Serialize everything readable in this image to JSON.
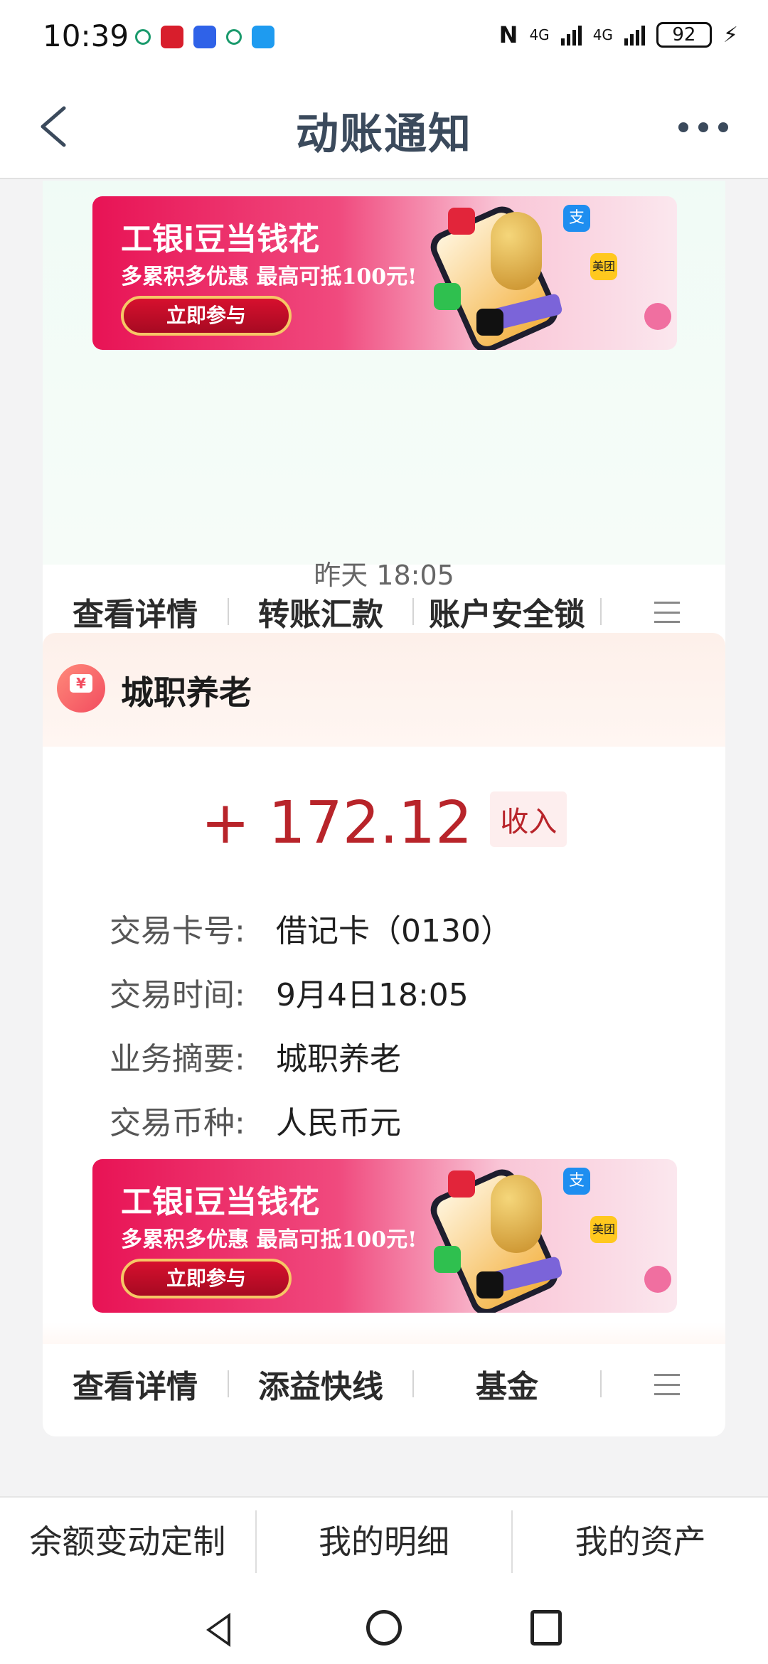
{
  "status_bar": {
    "time": "10:39",
    "network": "4G",
    "battery": "92"
  },
  "header": {
    "title": "动账通知"
  },
  "banner": {
    "title": "工银i豆当钱花",
    "subtitle": "多累积多优惠 最高可抵100元!",
    "button": "立即参与",
    "icon_texts": [
      "支",
      "美团"
    ]
  },
  "card1": {
    "actions": [
      "查看详情",
      "转账汇款",
      "账户安全锁"
    ]
  },
  "timestamp": "昨天 18:05",
  "card2": {
    "title": "城职养老",
    "amount": "+ 172.12",
    "amount_tag": "收入",
    "rows": [
      {
        "label": "交易卡号:",
        "value": "借记卡（0130）"
      },
      {
        "label": "交易时间:",
        "value": "9月4日18:05"
      },
      {
        "label": "业务摘要:",
        "value": "城职养老"
      },
      {
        "label": "交易币种:",
        "value": "人民币元"
      }
    ],
    "actions": [
      "查看详情",
      "添益快线",
      "基金"
    ]
  },
  "bottom_tabs": [
    "余额变动定制",
    "我的明细",
    "我的资产"
  ],
  "colors": {
    "amount_red": "#b8242a",
    "title_blue_gray": "#3b4a5c",
    "banner_pink": "#e81355"
  }
}
